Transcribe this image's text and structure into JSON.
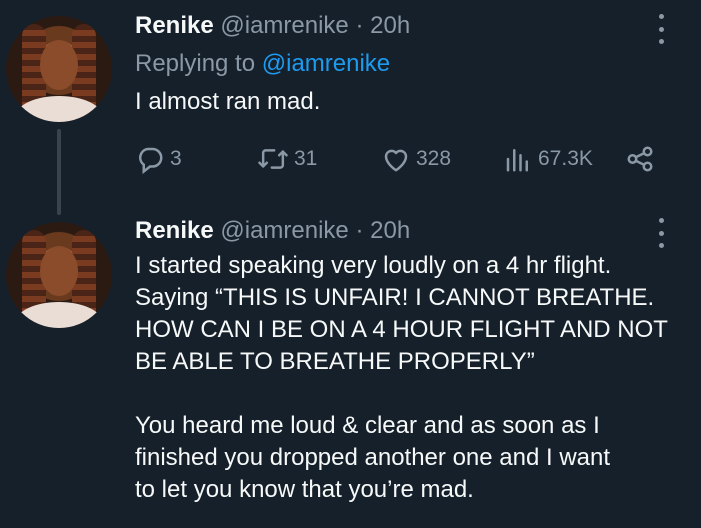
{
  "tweet1": {
    "author_name": "Renike",
    "author_handle": "@iamrenike",
    "separator": "·",
    "time": "20h",
    "replying_to_prefix": "Replying to",
    "replying_to_handle": "@iamrenike",
    "text": "I almost ran mad.",
    "stats": {
      "replies": "3",
      "reposts": "31",
      "likes": "328",
      "views": "67.3K"
    }
  },
  "tweet2": {
    "author_name": "Renike",
    "author_handle": "@iamrenike",
    "separator": "·",
    "time": "20h",
    "text": "I started speaking very loudly on a 4 hr flight.\nSaying “THIS IS UNFAIR! I CANNOT BREATHE.\nHOW CAN I BE ON A 4 HOUR FLIGHT AND NOT\nBE ABLE TO BREATHE PROPERLY”\n\nYou heard me loud & clear and as soon as I\nfinished you dropped another one and I want\nto let you know that you’re mad."
  },
  "icons": {
    "reply": "reply-icon",
    "repost": "repost-icon",
    "like": "heart-icon",
    "views": "views-icon",
    "share": "share-icon",
    "more": "more-icon"
  },
  "colors": {
    "background": "#15202b",
    "primary_text": "#f7f9f9",
    "secondary_text": "#8b98a5",
    "link": "#1d9bf0",
    "thread_line": "#38444d"
  }
}
